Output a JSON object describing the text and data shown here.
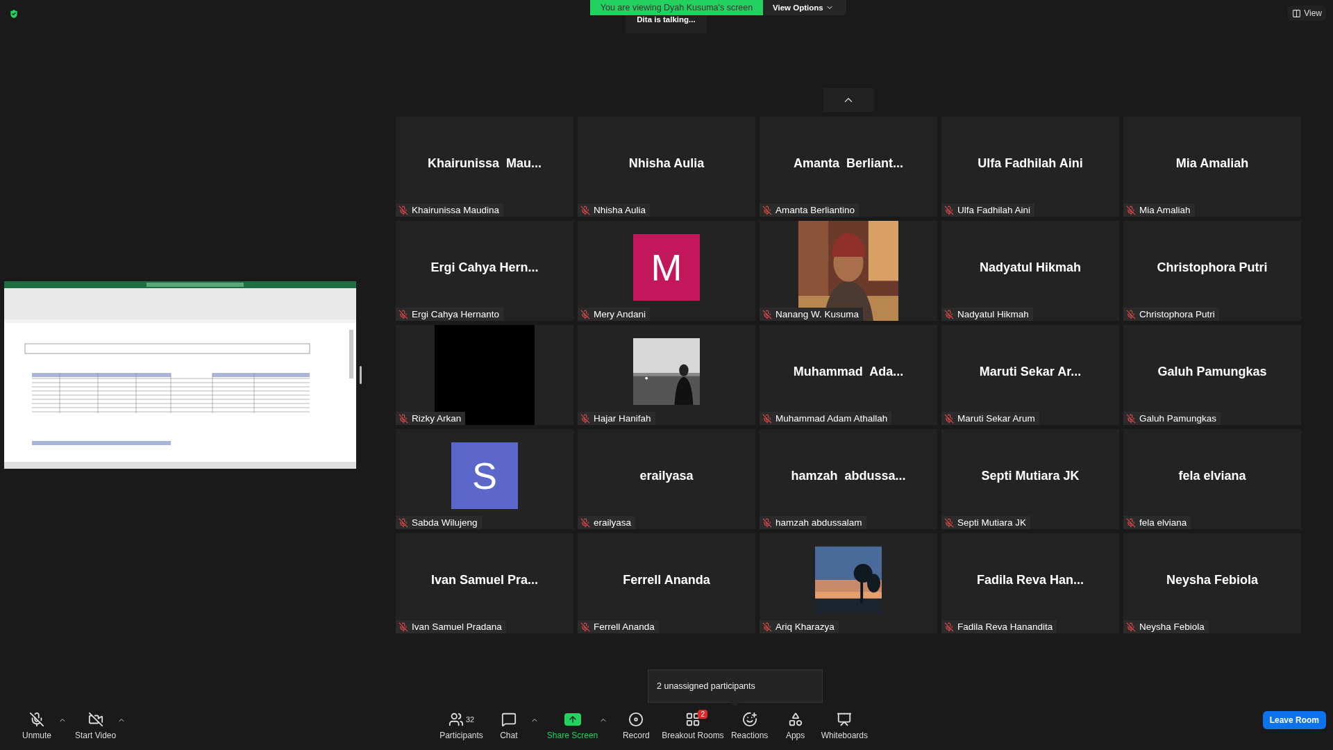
{
  "banner": {
    "text": "You are viewing Dyah Kusuma's screen",
    "options": "View Options"
  },
  "speaker_notice": "Dita is talking...",
  "view_button": "View",
  "tiles": [
    {
      "kind": "name",
      "display": "Khairunissa  Mau...",
      "label": "Khairunissa Maudina",
      "muted": true
    },
    {
      "kind": "name",
      "display": "Nhisha Aulia",
      "label": "Nhisha Aulia",
      "muted": true
    },
    {
      "kind": "name",
      "display": "Amanta  Berliant...",
      "label": "Amanta Berliantino",
      "muted": true
    },
    {
      "kind": "name",
      "display": "Ulfa Fadhilah Aini",
      "label": "Ulfa Fadhilah Aini",
      "muted": true
    },
    {
      "kind": "name",
      "display": "Mia Amaliah",
      "label": "Mia Amaliah",
      "muted": true
    },
    {
      "kind": "name",
      "display": "Ergi Cahya Hern...",
      "label": "Ergi Cahya Hernanto",
      "muted": true
    },
    {
      "kind": "avatar",
      "initial": "M",
      "color": "#c2185b",
      "label": "Mery Andani",
      "muted": true
    },
    {
      "kind": "video",
      "label": "Nanang W. Kusuma",
      "muted": true
    },
    {
      "kind": "name",
      "display": "Nadyatul Hikmah",
      "label": "Nadyatul Hikmah",
      "muted": true
    },
    {
      "kind": "name",
      "display": "Christophora Putri",
      "label": "Christophora Putri",
      "muted": true
    },
    {
      "kind": "dark_video",
      "label": "Rizky Arkan",
      "muted": true
    },
    {
      "label": "Hajar Hanifah",
      "muted": true
    },
    {
      "kind": "name",
      "display": "Muhammad  Ada...",
      "label": "Muhammad Adam Athallah",
      "muted": true
    },
    {
      "kind": "name",
      "display": "Maruti Sekar Ar...",
      "label": "Maruti Sekar Arum",
      "muted": true
    },
    {
      "kind": "name",
      "display": "Galuh Pamungkas",
      "label": "Galuh Pamungkas",
      "muted": true
    },
    {
      "kind": "avatar",
      "initial": "S",
      "color": "#5b67c9",
      "label": "Sabda Wilujeng",
      "muted": true
    },
    {
      "kind": "name",
      "display": "erailyasa",
      "label": "erailyasa",
      "muted": true
    },
    {
      "kind": "name",
      "display": "hamzah  abdussa...",
      "label": "hamzah abdussalam",
      "muted": true
    },
    {
      "kind": "name",
      "display": "Septi Mutiara JK",
      "label": "Septi Mutiara JK",
      "muted": true
    },
    {
      "kind": "name",
      "display": "fela elviana",
      "label": "fela elviana",
      "muted": true
    },
    {
      "kind": "name",
      "display": "Ivan Samuel Pra...",
      "label": "Ivan Samuel Pradana",
      "muted": true
    },
    {
      "kind": "name",
      "display": "Ferrell Ananda",
      "label": "Ferrell Ananda",
      "muted": true
    },
    {
      "label": "Ariq Kharazya",
      "muted": true
    },
    {
      "kind": "name",
      "display": "Fadila Reva Han...",
      "label": "Fadila Reva Hanandita",
      "muted": true
    },
    {
      "kind": "name",
      "display": "Neysha Febiola",
      "label": "Neysha Febiola",
      "muted": true
    }
  ],
  "tooltip": "2 unassigned participants",
  "toolbar": {
    "left": [
      {
        "kind": "audio",
        "label": "Unmute",
        "off": true,
        "has_menu": true
      },
      {
        "kind": "video",
        "label": "Start Video",
        "off": true,
        "has_menu": true
      }
    ],
    "center": [
      {
        "kind": "participants",
        "label": "Participants",
        "count": "32"
      },
      {
        "kind": "chat",
        "label": "Chat",
        "has_menu": true
      },
      {
        "kind": "share",
        "label": "Share Screen",
        "has_menu": true
      },
      {
        "kind": "record",
        "label": "Record"
      },
      {
        "kind": "breakout",
        "label": "Breakout Rooms",
        "badge": "2"
      },
      {
        "kind": "reactions",
        "label": "Reactions"
      },
      {
        "kind": "apps",
        "label": "Apps"
      },
      {
        "kind": "whiteboards",
        "label": "Whiteboards"
      }
    ],
    "leave": "Leave Room"
  }
}
